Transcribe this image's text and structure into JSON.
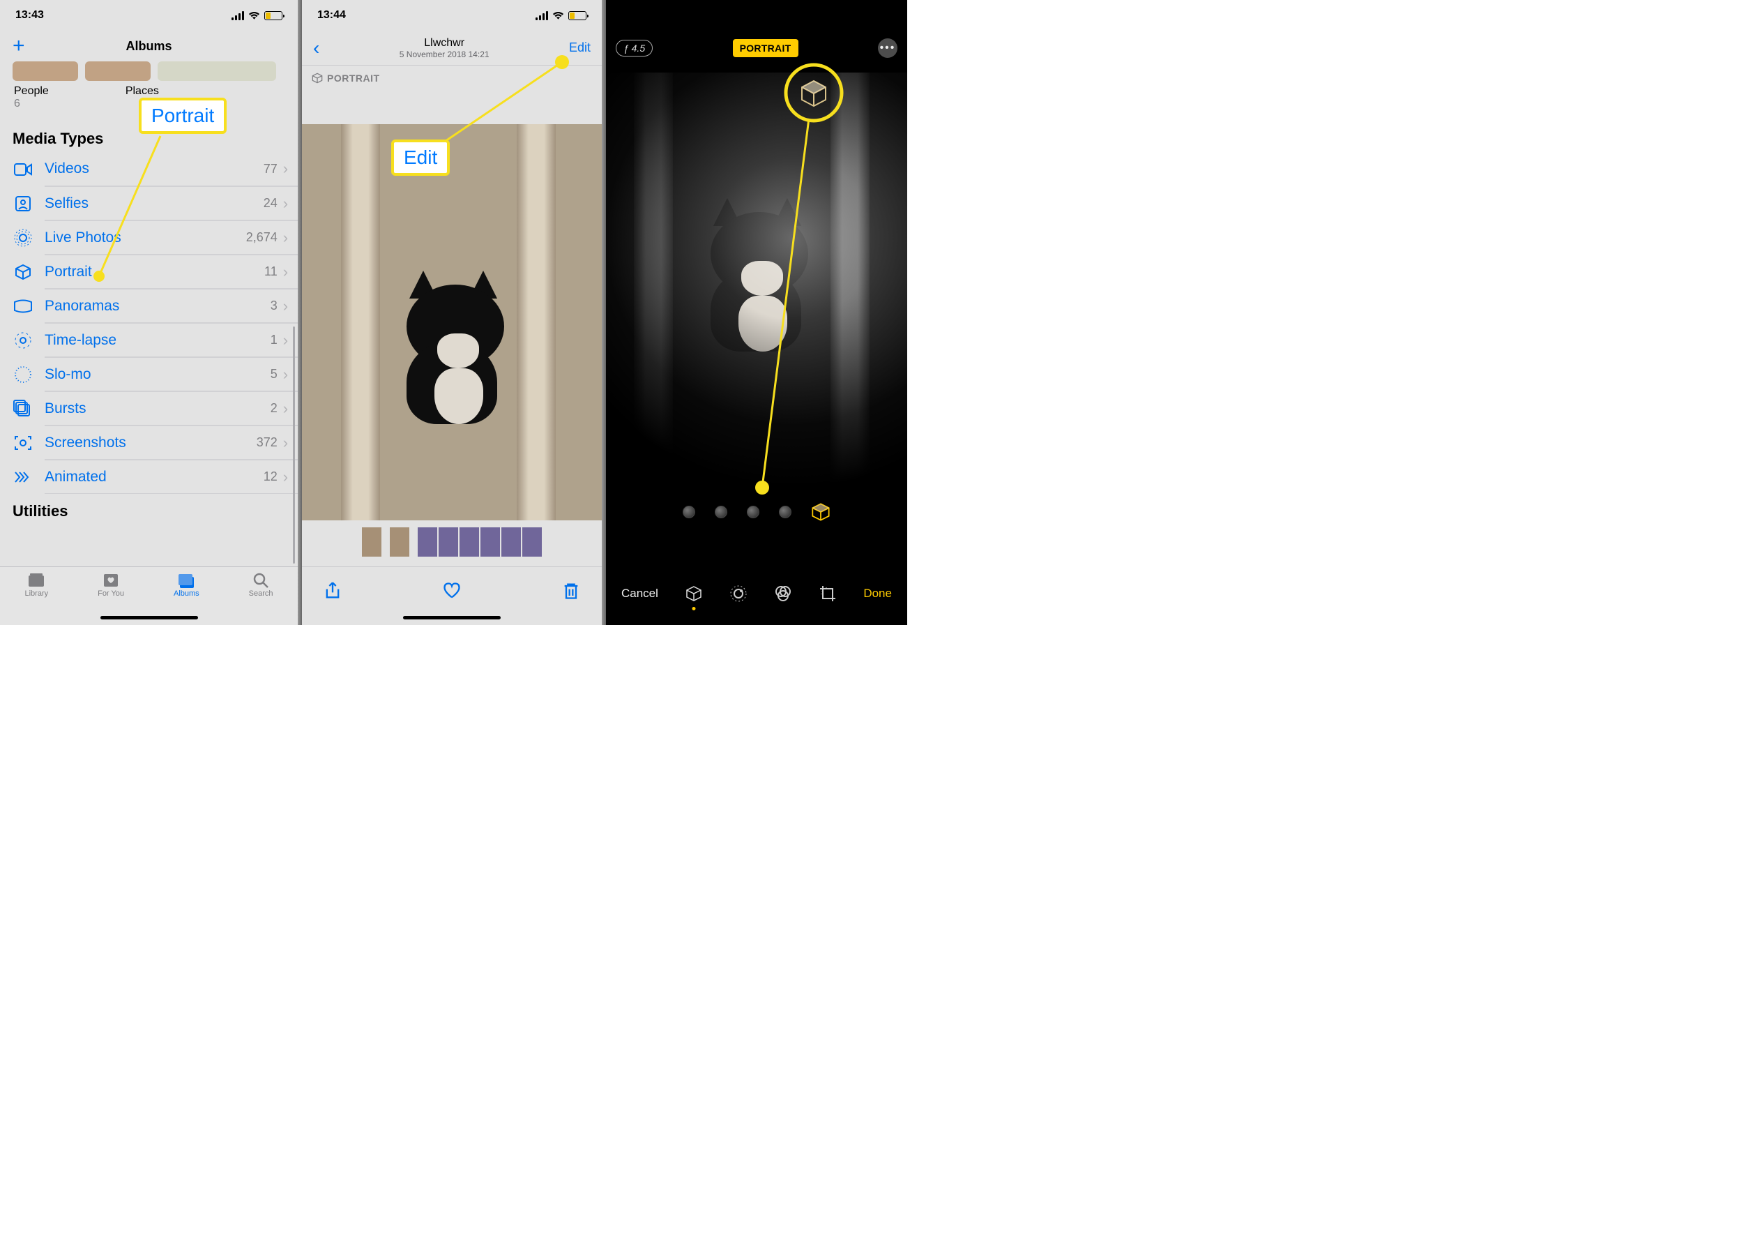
{
  "phone1": {
    "status_time": "13:43",
    "nav_title": "Albums",
    "tile_labels": {
      "people": "People",
      "places": "Places"
    },
    "people_count": "6",
    "section_media": "Media Types",
    "section_utilities": "Utilities",
    "rows": [
      {
        "icon": "videos",
        "label": "Videos",
        "count": "77"
      },
      {
        "icon": "selfies",
        "label": "Selfies",
        "count": "24"
      },
      {
        "icon": "livephotos",
        "label": "Live Photos",
        "count": "2,674"
      },
      {
        "icon": "portrait",
        "label": "Portrait",
        "count": "11"
      },
      {
        "icon": "panoramas",
        "label": "Panoramas",
        "count": "3"
      },
      {
        "icon": "timelapse",
        "label": "Time-lapse",
        "count": "1"
      },
      {
        "icon": "slomo",
        "label": "Slo-mo",
        "count": "5"
      },
      {
        "icon": "bursts",
        "label": "Bursts",
        "count": "2"
      },
      {
        "icon": "screenshots",
        "label": "Screenshots",
        "count": "372"
      },
      {
        "icon": "animated",
        "label": "Animated",
        "count": "12"
      }
    ],
    "tabs": {
      "library": "Library",
      "foryou": "For You",
      "albums": "Albums",
      "search": "Search"
    }
  },
  "phone2": {
    "status_time": "13:44",
    "title": "Llwchwr",
    "subtitle": "5 November 2018  14:21",
    "edit": "Edit",
    "portrait_badge": "PORTRAIT"
  },
  "phone3": {
    "fstop": "ƒ 4.5",
    "portrait_pill": "PORTRAIT",
    "cancel": "Cancel",
    "done": "Done"
  },
  "callouts": {
    "portrait": "Portrait",
    "edit": "Edit"
  }
}
